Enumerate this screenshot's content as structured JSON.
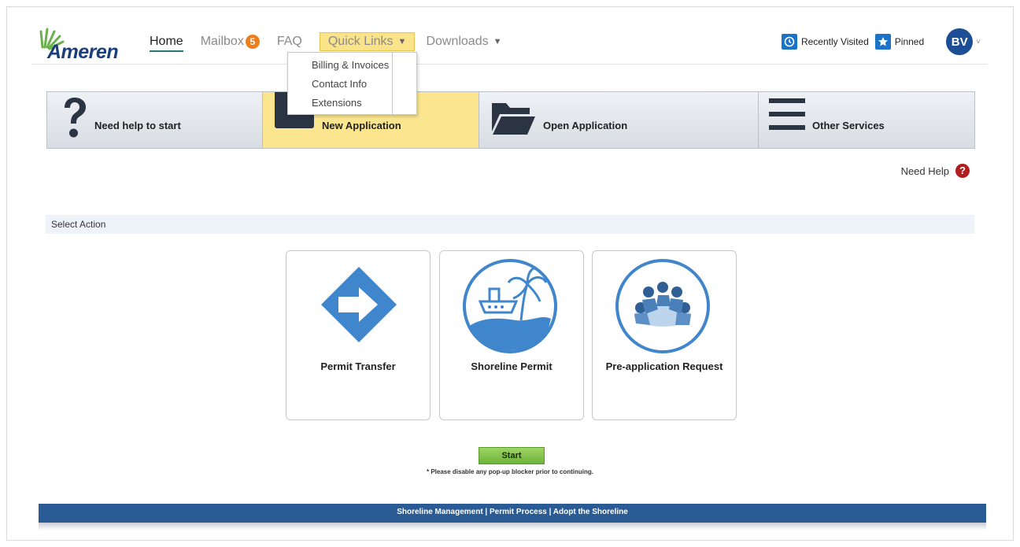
{
  "brand": {
    "name": "Ameren"
  },
  "nav": {
    "home": "Home",
    "mailbox": "Mailbox",
    "mailbox_count": "5",
    "faq": "FAQ",
    "quick_links": "Quick Links",
    "downloads": "Downloads"
  },
  "quick_links_menu": [
    "Billing & Invoices",
    "Contact Info",
    "Extensions"
  ],
  "tools": {
    "recent": "Recently Visited",
    "pinned": "Pinned",
    "avatar": "BV"
  },
  "tabs": {
    "help": "Need help to start",
    "new": "New Application",
    "open": "Open Application",
    "other": "Other Services"
  },
  "need_help": "Need Help",
  "section_title": "Select Action",
  "cards": {
    "transfer": "Permit Transfer",
    "shoreline": "Shoreline Permit",
    "preapp": "Pre-application Request"
  },
  "start_label": "Start",
  "note": "* Please disable any pop-up blocker prior to continuing.",
  "footer": "Shoreline Management | Permit Process | Adopt the Shoreline",
  "colors": {
    "brand_blue": "#1a3f7a",
    "active_tab": "#fbe58e",
    "icon_blue": "#3f86cc",
    "footer_blue": "#2b5b94",
    "start_green": "#7dbf45",
    "badge_orange": "#f07d1c"
  }
}
